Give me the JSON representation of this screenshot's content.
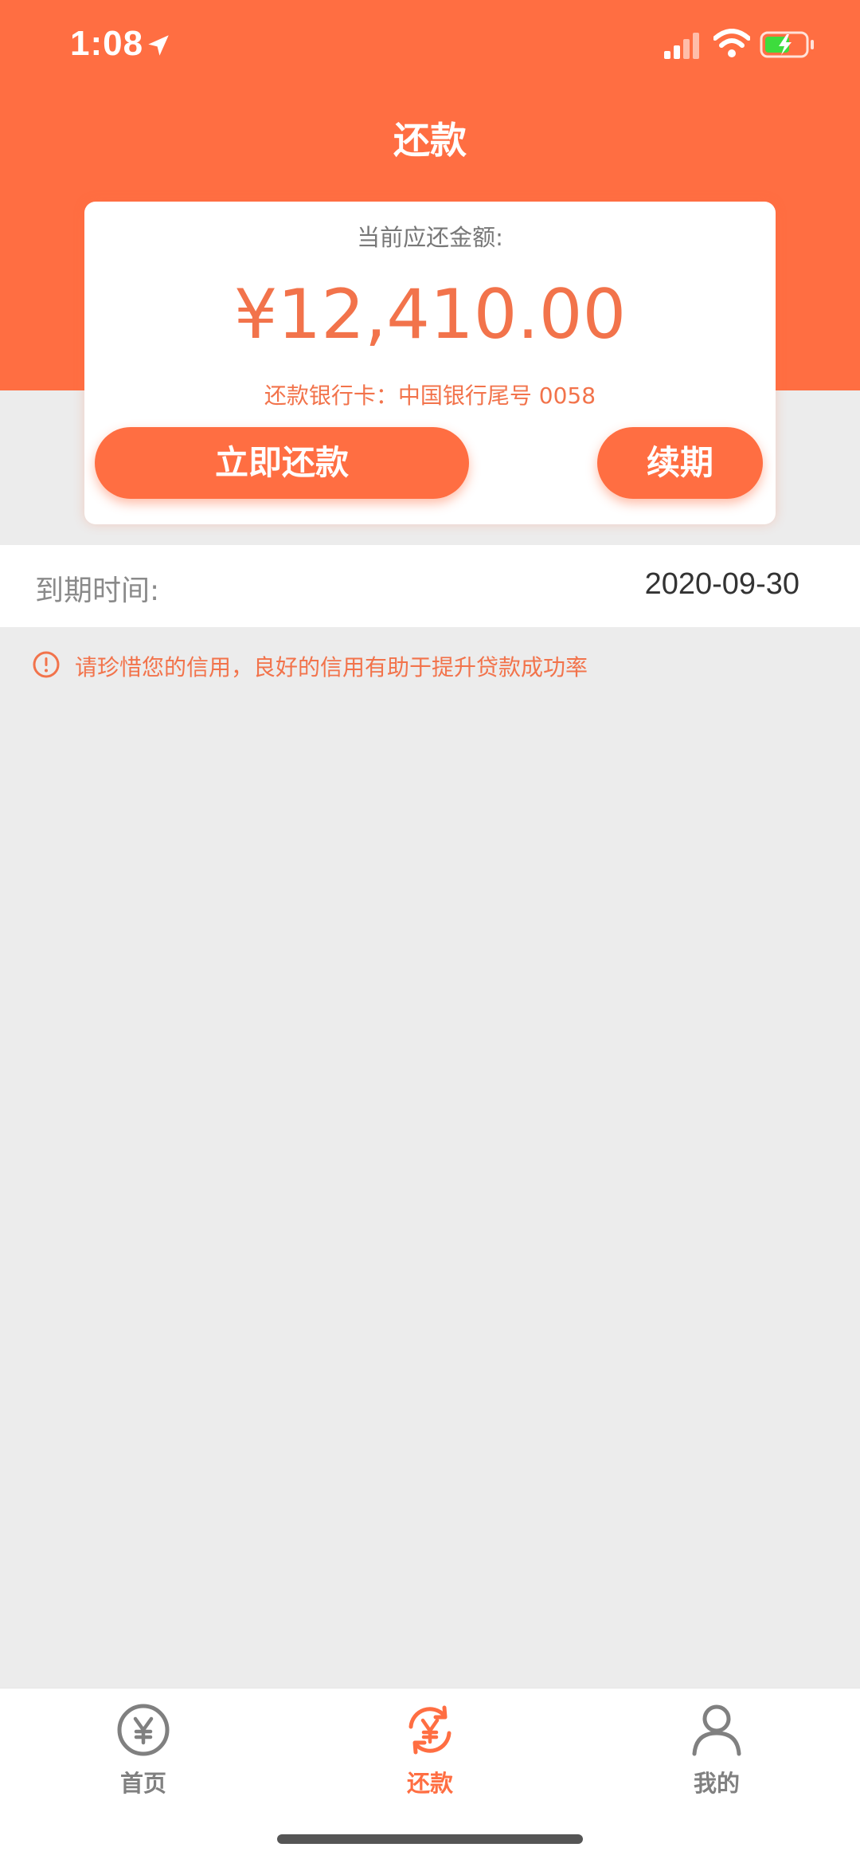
{
  "status_bar": {
    "time": "1:08"
  },
  "header": {
    "title": "还款"
  },
  "card": {
    "label": "当前应还金额:",
    "amount": "¥12,410.00",
    "bank_info": "还款银行卡：中国银行尾号 0058",
    "repay_button": "立即还款",
    "extend_button": "续期"
  },
  "due": {
    "label": "到期时间:",
    "value": "2020-09-30"
  },
  "tip": {
    "text": "请珍惜您的信用，良好的信用有助于提升贷款成功率"
  },
  "tabbar": {
    "items": [
      {
        "label": "首页",
        "icon": "yen-coin-icon",
        "active": false
      },
      {
        "label": "还款",
        "icon": "yen-refresh-icon",
        "active": true
      },
      {
        "label": "我的",
        "icon": "user-icon",
        "active": false
      }
    ]
  },
  "colors": {
    "accent": "#FF6E42",
    "accent_text": "#F2734B",
    "background": "#ECECEC",
    "inactive_tab": "#808080"
  }
}
